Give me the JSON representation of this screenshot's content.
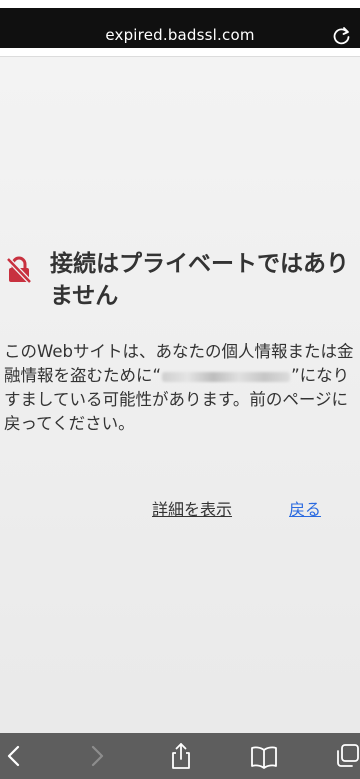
{
  "address_bar": {
    "url": "expired.badssl.com",
    "reload_icon": "reload-icon"
  },
  "error": {
    "icon": "lock-slash-icon",
    "title": "接続はプライベートではありません",
    "message_before": "このWebサイトは、あなたの個人情報または金融情報を盗むために“",
    "message_after": "”になりすましている可能性があります。前のページに戻ってください。",
    "details_link": "詳細を表示",
    "back_link": "戻る"
  },
  "toolbar": {
    "buttons": [
      {
        "icon": "back-arrow-icon",
        "enabled": true
      },
      {
        "icon": "forward-arrow-icon",
        "enabled": false
      },
      {
        "icon": "share-icon",
        "enabled": true
      },
      {
        "icon": "bookmarks-icon",
        "enabled": true
      },
      {
        "icon": "tabs-icon",
        "enabled": true
      }
    ]
  },
  "colors": {
    "link_blue": "#2a6ae0",
    "warning_red": "#c8313f",
    "toolbar_gray": "#5e5e5e"
  }
}
